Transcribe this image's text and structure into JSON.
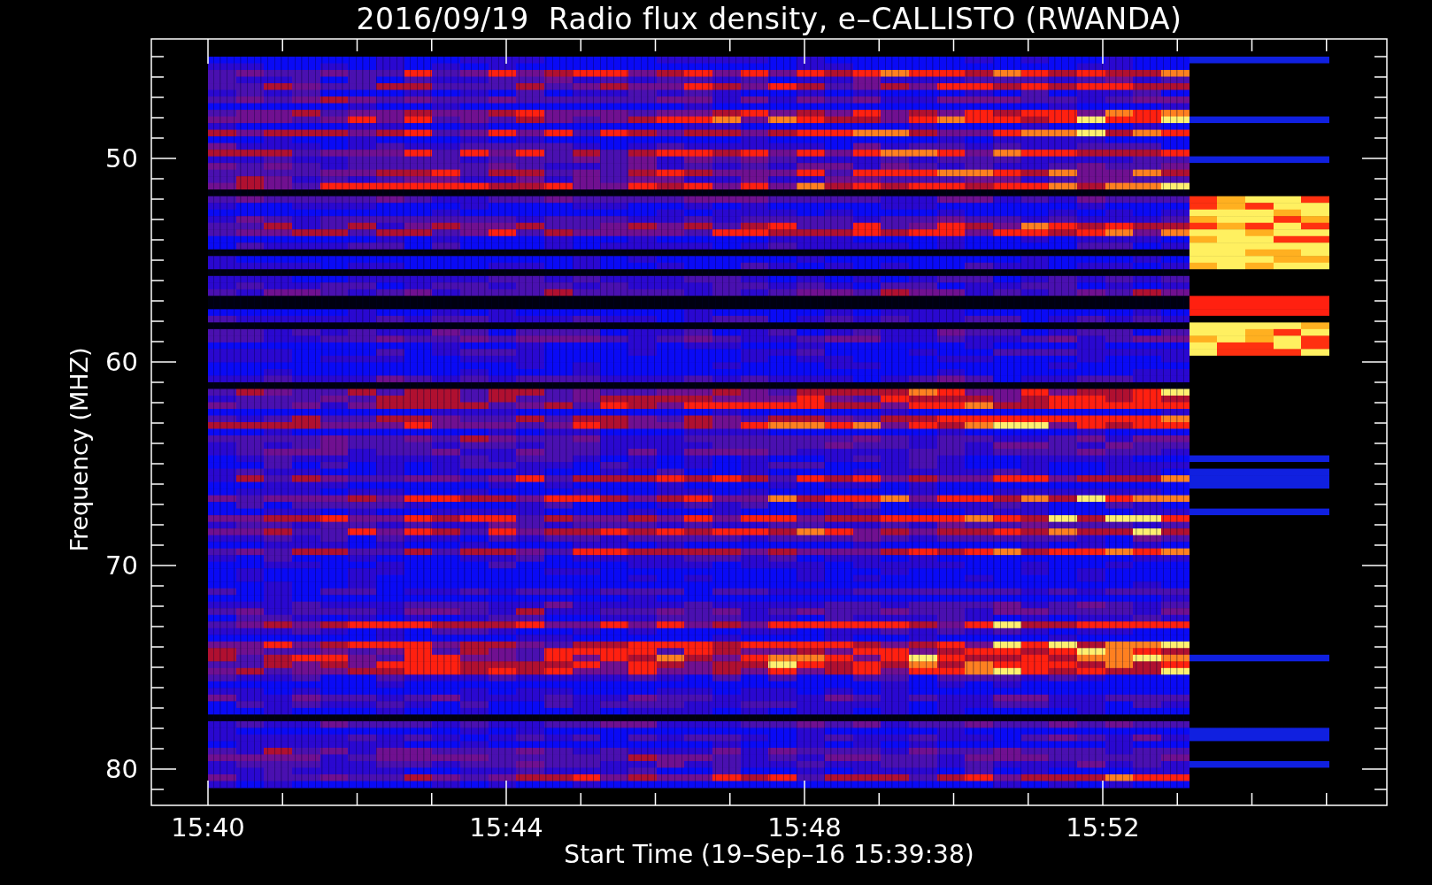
{
  "plot": {
    "title": "2016/09/19  Radio flux density, e–CALLISTO (RWANDA)",
    "ylabel": "Frequency (MHZ)",
    "xlabel": "Start Time (19–Sep–16 15:39:38)",
    "y_tick_labels": [
      "50",
      "60",
      "70",
      "80"
    ],
    "x_tick_labels": [
      "15:40",
      "15:44",
      "15:48",
      "15:52"
    ]
  }
}
